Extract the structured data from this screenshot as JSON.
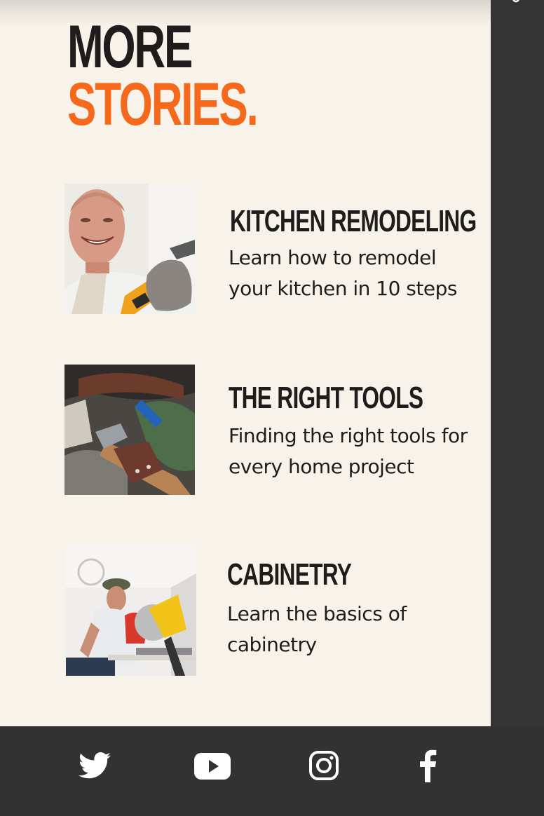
{
  "heading": {
    "line1": "MORE",
    "line2": "STORIES."
  },
  "stories": [
    {
      "title": "KITCHEN REMODELING",
      "description": "Learn how to remodel your kitchen in 10 steps",
      "image": "smiling-man-with-drill-photo"
    },
    {
      "title": "THE RIGHT TOOLS",
      "description": "Finding the right tools for every home project",
      "image": "tool-belt-with-hammer-photo"
    },
    {
      "title": "CABINETRY",
      "description": "Learn the basics of cabinetry",
      "image": "workers-with-miter-saw-photo"
    }
  ],
  "footer": {
    "social": [
      "twitter-icon",
      "youtube-icon",
      "instagram-icon",
      "facebook-icon"
    ]
  },
  "colors": {
    "accent": "#f4691c",
    "panel_bg": "#f8f3ea",
    "dark": "#333232",
    "text": "#1f1d1b"
  }
}
